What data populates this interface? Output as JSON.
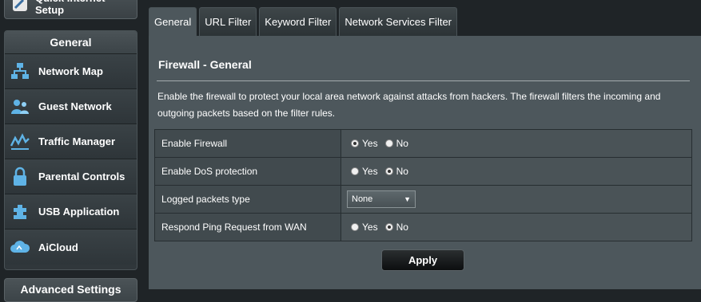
{
  "sidebar": {
    "quick_setup_label": "Quick Internet Setup",
    "general_header": "General",
    "items": [
      {
        "label": "Network Map",
        "icon": "network-map-icon"
      },
      {
        "label": "Guest Network",
        "icon": "guest-network-icon"
      },
      {
        "label": "Traffic Manager",
        "icon": "traffic-manager-icon"
      },
      {
        "label": "Parental Controls",
        "icon": "parental-controls-icon"
      },
      {
        "label": "USB Application",
        "icon": "usb-application-icon"
      },
      {
        "label": "AiCloud",
        "icon": "aicloud-icon"
      }
    ],
    "advanced_header": "Advanced Settings"
  },
  "tabs": [
    "General",
    "URL Filter",
    "Keyword Filter",
    "Network Services Filter"
  ],
  "active_tab": "General",
  "panel": {
    "title": "Firewall - General",
    "description": "Enable the firewall to protect your local area network against attacks from hackers. The firewall filters the incoming and outgoing packets based on the filter rules.",
    "rows": [
      {
        "label": "Enable Firewall",
        "yes": "Yes",
        "no": "No",
        "selected": "yes"
      },
      {
        "label": "Enable DoS protection",
        "yes": "Yes",
        "no": "No",
        "selected": "no"
      },
      {
        "label": "Logged packets type",
        "select_value": "None"
      },
      {
        "label": "Respond Ping Request from WAN",
        "yes": "Yes",
        "no": "No",
        "selected": "no"
      }
    ],
    "apply_label": "Apply"
  },
  "colors": {
    "panel_bg": "#4d575c",
    "sidebar_bg": "#30373b",
    "accent_icon": "#5fb3e6"
  }
}
